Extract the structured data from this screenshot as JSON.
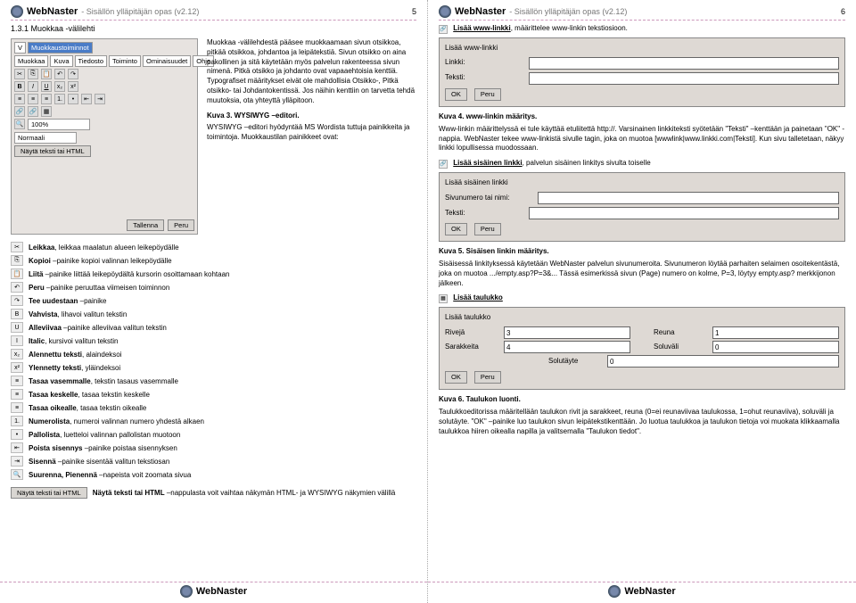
{
  "brand": "WebNaster",
  "guide_title": "- Sisällön ylläpitäjän opas (v2.12)",
  "page5": "5",
  "page6": "6",
  "section_1_3_1": "1.3.1 Muokkaa -välilehti",
  "editor": {
    "tab_v": "V",
    "tab_muokkaustoiminnot": "Muokkaustoiminnot",
    "tabs": [
      "Muokkaa",
      "Kuva",
      "Tiedosto",
      "Toiminto",
      "Ominaisuudet",
      "Ohje"
    ],
    "bold": "B",
    "italic": "I",
    "underline": "U",
    "sub": "x₂",
    "sup": "x²",
    "zoom": "100%",
    "style": "Normaali",
    "html_btn": "Näytä teksti tai HTML",
    "save": "Tallenna",
    "cancel": "Peru"
  },
  "para1": "Muokkaa -välilehdestä pääsee muokkaamaan sivun otsikkoa, pitkää otsikkoa, johdantoa ja leipätekstiä. Sivun otsikko on aina pakollinen ja sitä käytetään myös palvelun rakenteessa sivun nimenä. Pitkä otsikko ja johdanto ovat vapaaehtoisia kenttiä. Typografiset määritykset eivät ole mahdollisia Otsikko-, Pitkä otsikko- tai Johdantokentissä. Jos näihin kenttiin on tarvetta tehdä muutoksia, ota yhteyttä ylläpitoon.",
  "kuva3_caption": "Kuva 3. WYSIWYG –editori.",
  "kuva3_text": "WYSIWYG –editori hyödyntää MS Wordista tuttuja painikkeita ja toimintoja. Muokkaustilan painikkeet ovat:",
  "icon_list": [
    {
      "b": "Leikkaa",
      "t": ", leikkaa maalatun alueen leikepöydälle"
    },
    {
      "b": "Kopioi",
      "t": " –painike kopioi valinnan leikepöydälle"
    },
    {
      "b": "Liitä",
      "t": " –painike liittää leikepöydältä kursorin osoittamaan kohtaan"
    },
    {
      "b": "Peru",
      "t": " –painike peruuttaa viimeisen toiminnon"
    },
    {
      "b": "Tee uudestaan",
      "t": " –painike"
    },
    {
      "b": "Vahvista",
      "t": ", lihavoi valitun tekstin"
    },
    {
      "b": "Alleviivaa",
      "t": " –painike alleviivaa valitun tekstin"
    },
    {
      "b": "Italic",
      "t": ", kursivoi valitun tekstin"
    },
    {
      "b": "Alennettu teksti",
      "t": ", alaindeksoi"
    },
    {
      "b": "Ylennetty teksti",
      "t": ", yläindeksoi"
    },
    {
      "b": "Tasaa vasemmalle",
      "t": ", tekstin tasaus vasemmalle"
    },
    {
      "b": "Tasaa keskelle",
      "t": ", tasaa tekstin keskelle"
    },
    {
      "b": "Tasaa oikealle",
      "t": ", tasaa tekstin oikealle"
    },
    {
      "b": "Numerolista",
      "t": ", numeroi valinnan numero yhdestä alkaen"
    },
    {
      "b": "Pallolista",
      "t": ", luetteloi valinnan pallolistan muotoon"
    },
    {
      "b": "Poista sisennys",
      "t": " –painike poistaa sisennyksen"
    },
    {
      "b": "Sisennä",
      "t": " –painike sisentää valitun tekstiosan"
    },
    {
      "b": "Suurenna, Pienennä",
      "t": " –napeista voit zoomata sivua"
    }
  ],
  "html_toggle_line_b": "Näytä teksti tai HTML",
  "html_toggle_line_t": " –nappulasta voit vaihtaa näkymän HTML- ja WYSIWYG näkymien välillä",
  "p6": {
    "intro_b": "Lisää www-linkki",
    "intro_t": ", määrittelee www-linkin tekstiosioon.",
    "dlg1_title": "Lisää www-linkki",
    "linkki": "Linkki:",
    "teksti": "Teksti:",
    "ok": "OK",
    "peru": "Peru",
    "kuva4": "Kuva 4. www-linkin määritys.",
    "kuva4_text": "Www-linkin määrittelyssä ei tule käyttää etuliitettä http://. Varsinainen linkkiteksti syötetään \"Teksti\" –kenttään ja painetaan \"OK\" -nappia. WebNaster tekee www-linkistä sivulle tagin, joka on muotoa [wwwlink|www.linkki.com|Teksti]. Kun sivu talletetaan, näkyy linkki lopullisessa muodossaan.",
    "intro2_b": "Lisää sisäinen linkki",
    "intro2_t": ", palvelun sisäinen linkitys sivulta toiselle",
    "dlg2_title": "Lisää sisäinen linkki",
    "sivunum": "Sivunumero tai nimi:",
    "kuva5": "Kuva 5. Sisäisen linkin määritys.",
    "kuva5_text": "Sisäisessä linkityksessä käytetään WebNaster palvelun sivunumeroita. Sivunumeron löytää parhaiten selaimen osoitekentästä, joka on muotoa .../empty.asp?P=3&... Tässä esimerkissä sivun (Page) numero on kolme, P=3, löytyy empty.asp? merkkijonon jälkeen.",
    "intro3_b": "Lisää taulukko",
    "dlg3_title": "Lisää taulukko",
    "riveja": "Rivejä",
    "riveja_v": "3",
    "reuna": "Reuna",
    "reuna_v": "1",
    "sarakkeita": "Sarakkeita",
    "sarakkeita_v": "4",
    "soluvali": "Soluväli",
    "soluvali_v": "0",
    "solutayte": "Solutäyte",
    "solutayte_v": "0",
    "kuva6": "Kuva 6. Taulukon luonti.",
    "kuva6_text": "Taulukkoeditorissa määritellään taulukon rivit ja sarakkeet, reuna (0=ei reunaviivaa taulukossa, 1=ohut reunaviiva), soluväli ja solutäyte. \"OK\" –painike luo taulukon sivun leipätekstikenttään. Jo luotua taulukkoa ja taulukon tietoja voi muokata klikkaamalla taulukkoa hiiren oikealla napilla ja valitsemalla \"Taulukon tiedot\"."
  }
}
